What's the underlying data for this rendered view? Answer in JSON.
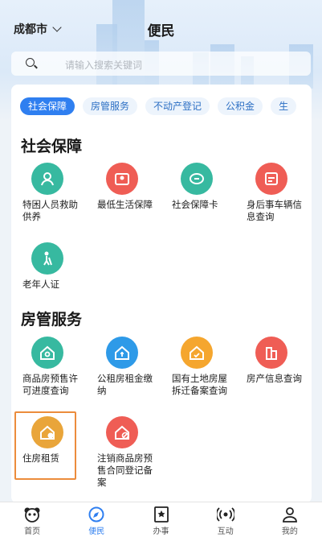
{
  "header": {
    "city": "成都市",
    "title": "便民"
  },
  "search": {
    "placeholder": "请输入搜索关键词"
  },
  "tabs": [
    "社会保障",
    "房管服务",
    "不动产登记",
    "公积金",
    "生"
  ],
  "sections": [
    {
      "title": "社会保障",
      "items": [
        {
          "label": "特困人员救助供养",
          "icon": "person-shield-icon",
          "color": "#37b9a0"
        },
        {
          "label": "最低生活保障",
          "icon": "family-icon",
          "color": "#ef5d55"
        },
        {
          "label": "社会保障卡",
          "icon": "card-icon",
          "color": "#37b9a0"
        },
        {
          "label": "身后事车辆信息查询",
          "icon": "vehicle-icon",
          "color": "#ef5d55"
        },
        {
          "label": "老年人证",
          "icon": "elder-icon",
          "color": "#37b9a0"
        }
      ]
    },
    {
      "title": "房管服务",
      "items": [
        {
          "label": "商品房预售许可进度查询",
          "icon": "house-search-icon",
          "color": "#37b9a0"
        },
        {
          "label": "公租房租金缴纳",
          "icon": "house-pay-icon",
          "color": "#2e9ae8"
        },
        {
          "label": "国有土地房屋拆迁备案查询",
          "icon": "house-check-icon",
          "color": "#f5a62e"
        },
        {
          "label": "房产信息查询",
          "icon": "building-icon",
          "color": "#ef5d55"
        },
        {
          "label": "住房租赁",
          "icon": "house-rent-icon",
          "color": "#e9a53a"
        },
        {
          "label": "注销商品房预售合同登记备案",
          "icon": "house-cancel-icon",
          "color": "#ef5d55"
        }
      ]
    }
  ],
  "tabbar": [
    {
      "label": "首页",
      "icon": "panda-icon"
    },
    {
      "label": "便民",
      "icon": "compass-icon"
    },
    {
      "label": "办事",
      "icon": "star-doc-icon"
    },
    {
      "label": "互动",
      "icon": "broadcast-icon"
    },
    {
      "label": "我的",
      "icon": "user-icon"
    }
  ],
  "colors": {
    "accent": "#2f7ff0",
    "highlight": "#ec8c3c"
  }
}
